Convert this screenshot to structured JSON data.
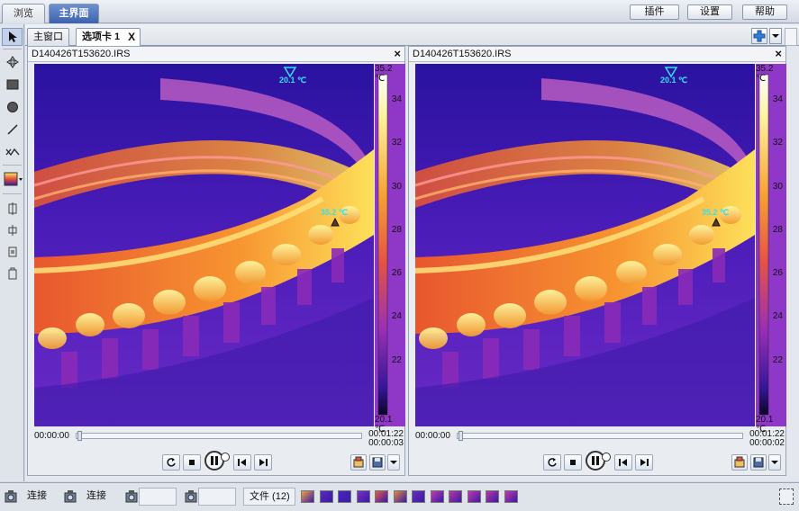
{
  "topbar": {
    "tabs": [
      {
        "label": "浏览",
        "active": false
      },
      {
        "label": "主界面",
        "active": true
      }
    ],
    "buttons": {
      "plugin": "插件",
      "settings": "设置",
      "help": "帮助"
    }
  },
  "tools": [
    "pointer-icon",
    "move-icon",
    "rectangle-icon",
    "ellipse-icon",
    "line-icon",
    "polyline-icon",
    "palette-icon",
    "tool-1-icon",
    "tool-2-icon",
    "tool-3-icon",
    "tool-4-icon"
  ],
  "subtabs": {
    "main_window": "主窗口",
    "tab1": "选项卡 1",
    "close": "X"
  },
  "panels": [
    {
      "filename": "D140426T153620.IRS",
      "min_marker": "20.1 ℃",
      "max_marker": "35.2 ℃",
      "scale": {
        "top": "35.2 ℃",
        "bottom": "20.1 ℃",
        "ticks": [
          "34",
          "32",
          "30",
          "28",
          "26",
          "24",
          "22"
        ]
      },
      "time_start": "00:00:00",
      "time_total": "00:01:22",
      "time_current": "00:00:03"
    },
    {
      "filename": "D140426T153620.IRS",
      "min_marker": "20.1 ℃",
      "max_marker": "35.2 ℃",
      "scale": {
        "top": "35.2 ℃",
        "bottom": "20.1 ℃",
        "ticks": [
          "34",
          "32",
          "30",
          "28",
          "26",
          "24",
          "22"
        ]
      },
      "time_start": "00:00:00",
      "time_total": "00:01:22",
      "time_current": "00:00:02"
    }
  ],
  "status": {
    "connect1": "连接",
    "connect2": "连接",
    "files": "文件 (12)"
  },
  "colors": {
    "accent": "#3d63ad",
    "marker_cyan": "#35e0f0"
  }
}
